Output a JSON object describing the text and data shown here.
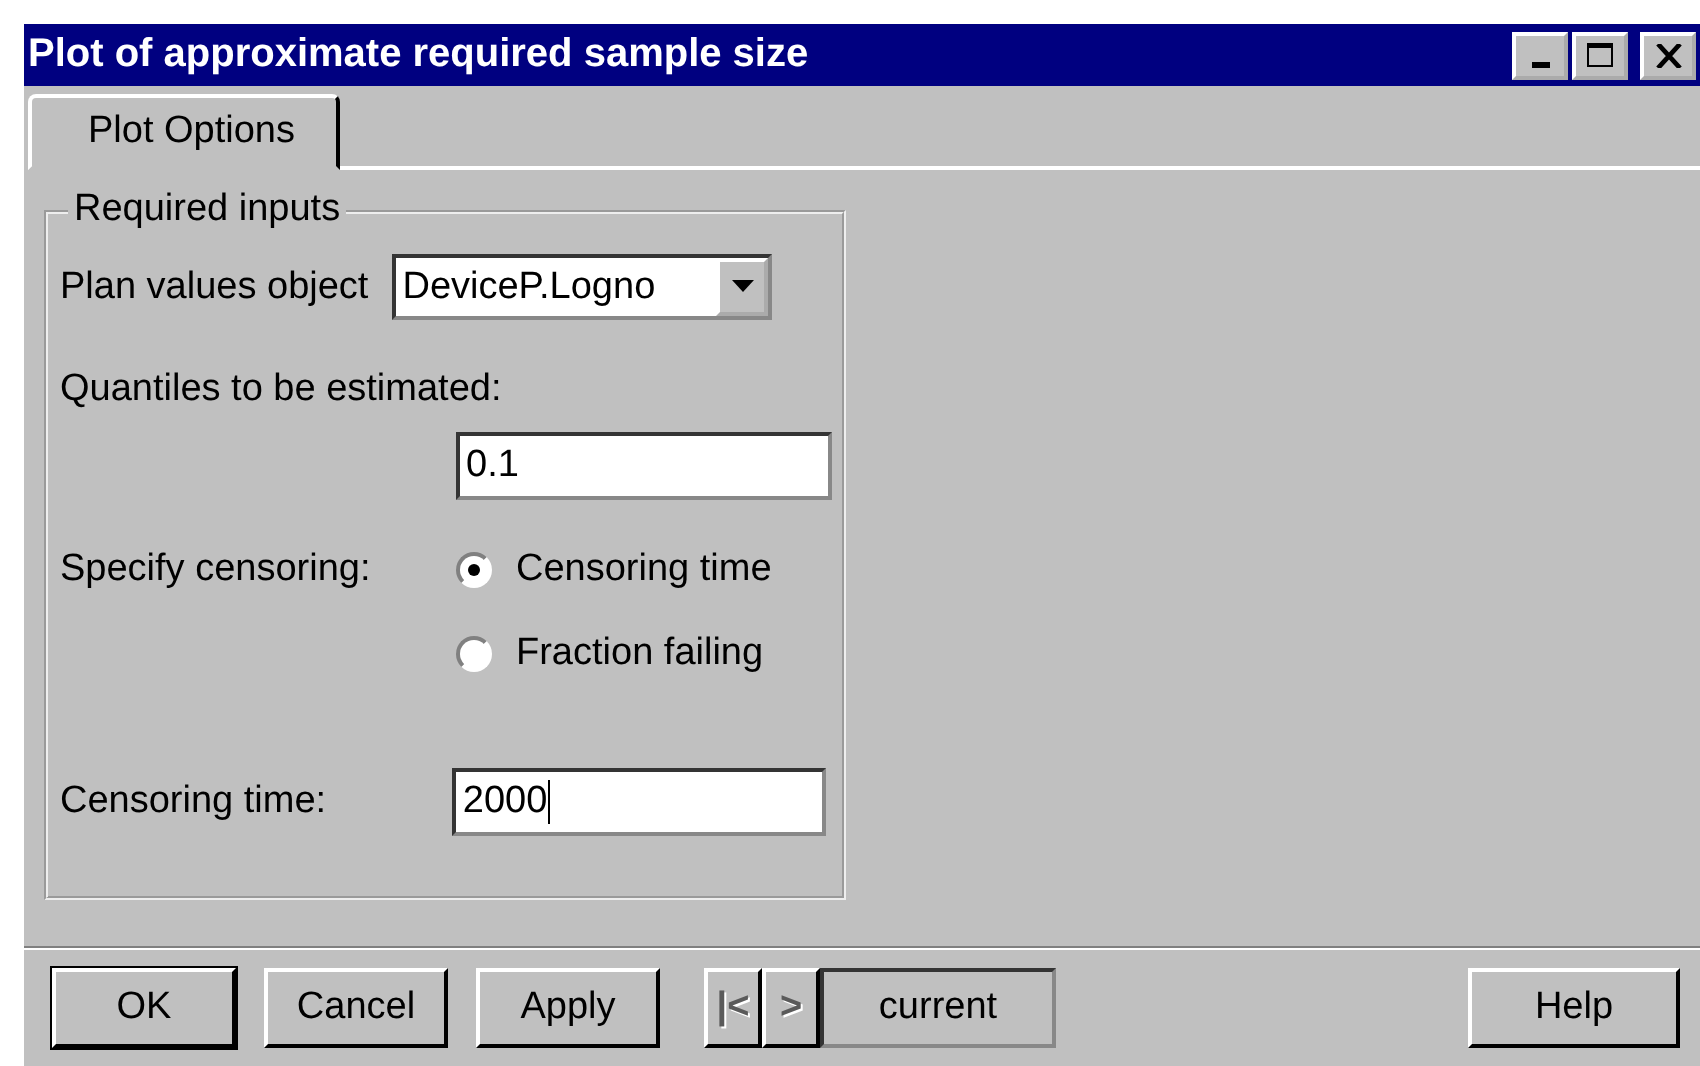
{
  "window": {
    "title": "Plot of approximate required sample size"
  },
  "tabs": [
    {
      "label": "Plot Options",
      "selected": true
    }
  ],
  "group": {
    "title": "Required inputs",
    "plan": {
      "label": "Plan values object",
      "value": "DeviceP.Logno"
    },
    "quantiles": {
      "label": "Quantiles to be estimated:",
      "value": "0.1"
    },
    "censoring": {
      "label": "Specify censoring:",
      "options": [
        {
          "label": "Censoring time",
          "selected": true
        },
        {
          "label": "Fraction failing",
          "selected": false
        }
      ]
    },
    "censoring_time": {
      "label": "Censoring time:",
      "value": "2000",
      "focused": true
    }
  },
  "buttons": [
    {
      "label": "OK",
      "default": true
    },
    {
      "label": "Cancel",
      "default": false
    },
    {
      "label": "Apply",
      "default": false
    }
  ],
  "nav": [
    {
      "label": "|<",
      "disabled": true
    },
    {
      "label": ">",
      "disabled": true
    }
  ],
  "current": "current",
  "help": "Help"
}
